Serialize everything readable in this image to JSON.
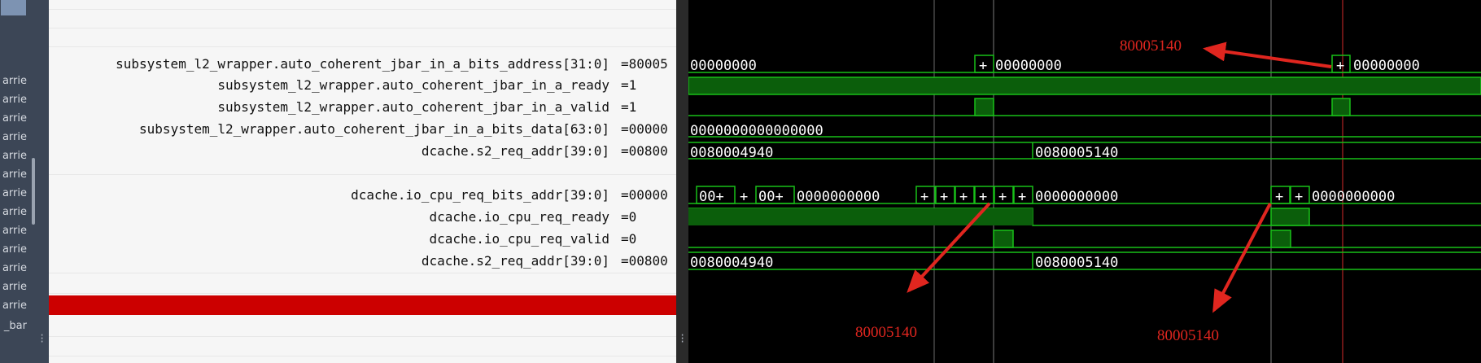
{
  "tree": {
    "items": [
      "arrie",
      "arrie",
      "arrie",
      "arrie",
      "arrie",
      "arrie",
      "arrie",
      "arrie",
      "arrie",
      "arrie",
      "arrie",
      "arrie",
      "arrie",
      "_bar"
    ]
  },
  "signals": [
    {
      "name": "subsystem_l2_wrapper.auto_coherent_jbar_in_a_bits_address[31:0]",
      "value": "=80005"
    },
    {
      "name": "subsystem_l2_wrapper.auto_coherent_jbar_in_a_ready",
      "value": "=1"
    },
    {
      "name": "subsystem_l2_wrapper.auto_coherent_jbar_in_a_valid",
      "value": "=1"
    },
    {
      "name": "subsystem_l2_wrapper.auto_coherent_jbar_in_a_bits_data[63:0]",
      "value": "=00000"
    },
    {
      "name": "dcache.s2_req_addr[39:0]",
      "value": "=00800"
    },
    {
      "name": "dcache.io_cpu_req_bits_addr[39:0]",
      "value": "=00000"
    },
    {
      "name": "dcache.io_cpu_req_ready",
      "value": "=0"
    },
    {
      "name": "dcache.io_cpu_req_valid",
      "value": "=0"
    },
    {
      "name": "dcache.s2_req_addr[39:0]",
      "value": "=00800"
    }
  ],
  "waves": {
    "addr_a_1": "00000000",
    "addr_a_2": "00000000",
    "addr_a_3": "00000000",
    "data": "0000000000000000",
    "s2_1a": "0080004940",
    "s2_1b": "0080005140",
    "cpu_1": "00+",
    "cpu_2": "00+",
    "cpu_3": "0000000000",
    "cpu_4": "0000000000",
    "cpu_5": "0000000000",
    "s2_2a": "0080004940",
    "s2_2b": "0080005140",
    "plus": "+"
  },
  "annotations": {
    "top": "80005140",
    "bottom_left": "80005140",
    "bottom_right": "80005140"
  },
  "colors": {
    "wave": "#19c019",
    "wave_fill": "#0b5e0b",
    "annotation": "#e0261f",
    "highlight": "#cc0000"
  }
}
